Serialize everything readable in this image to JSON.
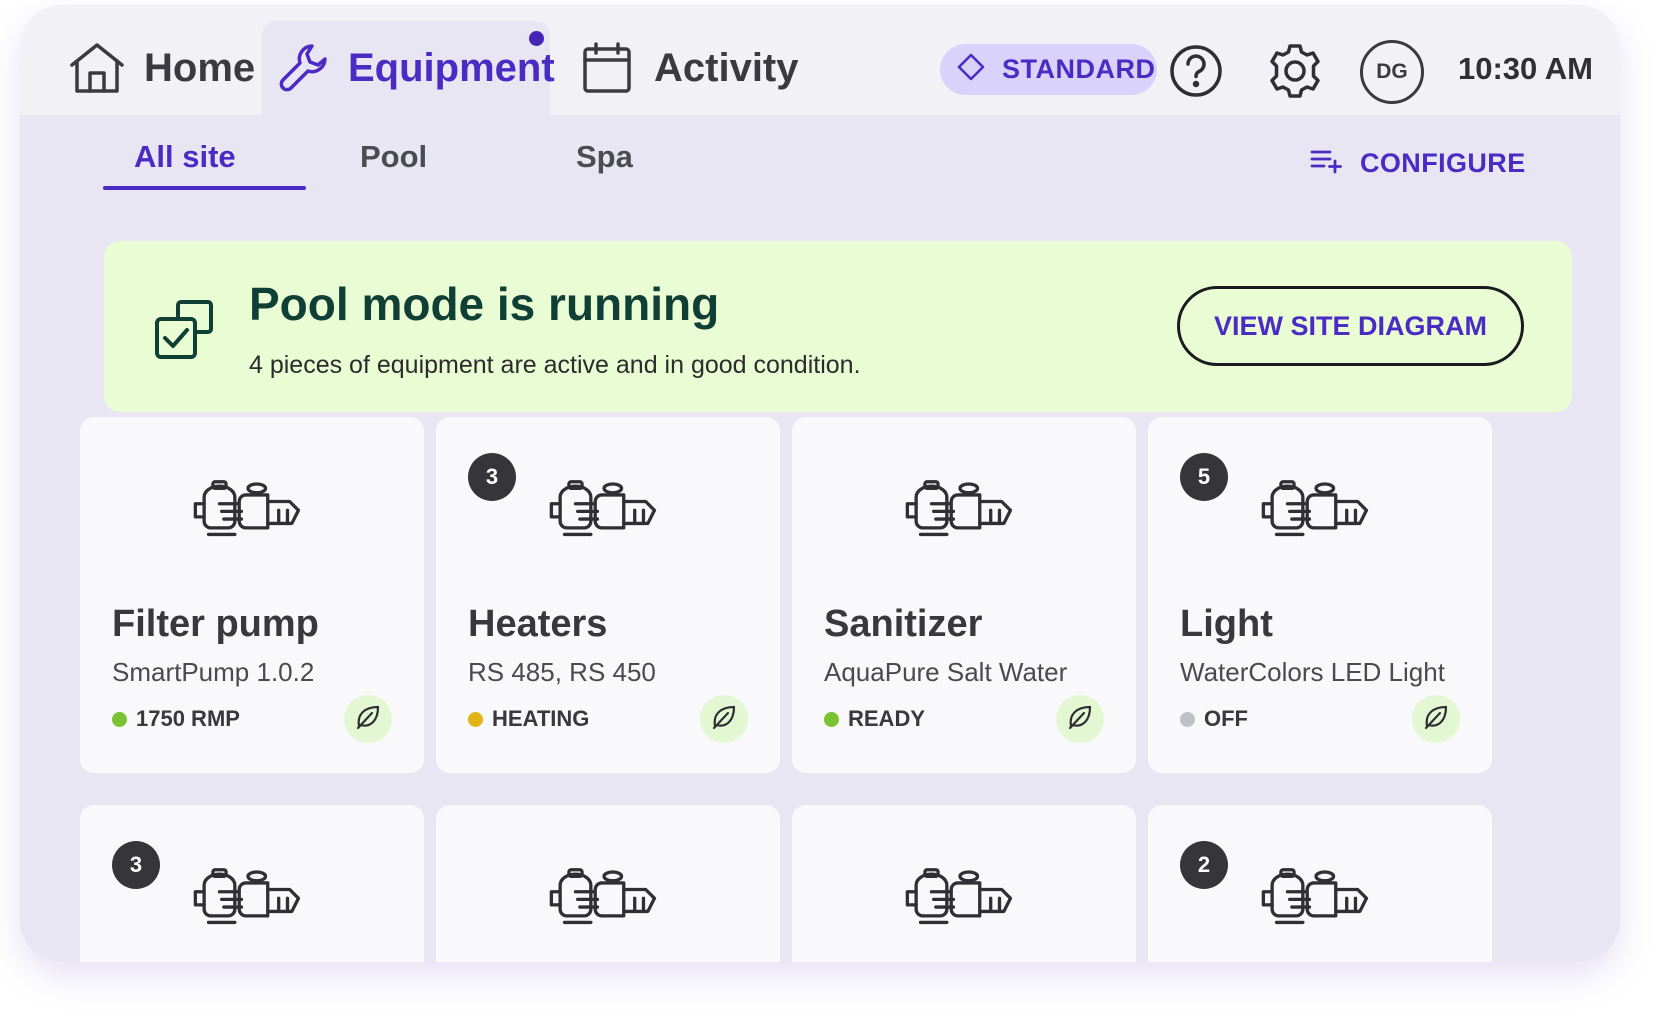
{
  "nav": {
    "tabs": [
      {
        "label": "Home",
        "icon": "home-icon"
      },
      {
        "label": "Equipment",
        "icon": "wrench-icon"
      },
      {
        "label": "Activity",
        "icon": "calendar-icon"
      }
    ],
    "tier_label": "STANDARD",
    "avatar_initials": "DG",
    "time": "10:30 AM"
  },
  "subnav": {
    "tabs": [
      {
        "label": "All site"
      },
      {
        "label": "Pool"
      },
      {
        "label": "Spa"
      }
    ],
    "configure_label": "CONFIGURE"
  },
  "banner": {
    "title": "Pool mode is running",
    "subtitle": "4 pieces of equipment are active and in good condition.",
    "button_label": "VIEW SITE DIAGRAM"
  },
  "cards": [
    {
      "title": "Filter pump",
      "subtitle": "SmartPump 1.0.2",
      "status": "1750 RMP",
      "status_color": "#7ac231",
      "badge": null
    },
    {
      "title": "Heaters",
      "subtitle": "RS 485, RS 450",
      "status": "HEATING",
      "status_color": "#e2b417",
      "badge": "3"
    },
    {
      "title": "Sanitizer",
      "subtitle": "AquaPure Salt Water",
      "status": "READY",
      "status_color": "#7ac231",
      "badge": null
    },
    {
      "title": "Light",
      "subtitle": "WaterColors LED Light",
      "status": "OFF",
      "status_color": "#c0c0c8",
      "badge": "5"
    },
    {
      "badge": "3"
    },
    {
      "badge": null
    },
    {
      "badge": null
    },
    {
      "badge": "2"
    }
  ],
  "colors": {
    "accent": "#4a2cc4",
    "banner_bg": "#e9fcd4",
    "banner_title": "#103f36",
    "eco_bg": "#e3f8d2"
  }
}
